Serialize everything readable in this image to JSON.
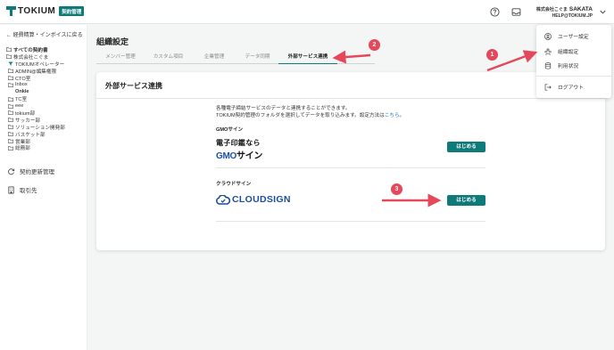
{
  "header": {
    "logo_text": "TOKIUM",
    "logo_badge": "契約管理",
    "user_company": "株式会社こぐま",
    "user_name": "SAKATA",
    "user_email": "HELP@TOKIUM.JP",
    "icons": [
      "help-icon",
      "inbox-icon",
      "chevron-down-icon"
    ]
  },
  "sidebar": {
    "back_link": "← 経費精算・インボイスに戻る",
    "tree": [
      {
        "label": "すべての契約書",
        "level": 0,
        "bold": true
      },
      {
        "label": "株式会社こぐま",
        "level": 0,
        "bold": false
      },
      {
        "label": "TOKIUMオペレーター",
        "level": 1,
        "bold": false,
        "icon": "filter"
      },
      {
        "label": "ADMIN@編集権限",
        "level": 1,
        "bold": false
      },
      {
        "label": "CTO室",
        "level": 1,
        "bold": false
      },
      {
        "label": "Inbox",
        "level": 1,
        "bold": false
      },
      {
        "label": "Onkle",
        "level": 1,
        "bold": true
      },
      {
        "label": "TC室",
        "level": 1,
        "bold": false
      },
      {
        "label": "eee",
        "level": 1,
        "bold": false
      },
      {
        "label": "tokium部",
        "level": 1,
        "bold": false
      },
      {
        "label": "サッカー部",
        "level": 1,
        "bold": false
      },
      {
        "label": "ソリューション開発部",
        "level": 1,
        "bold": false
      },
      {
        "label": "バスケット部",
        "level": 1,
        "bold": false
      },
      {
        "label": "営業部",
        "level": 1,
        "bold": false
      },
      {
        "label": "総務部",
        "level": 1,
        "bold": false
      }
    ],
    "nav": [
      {
        "label": "契約更新管理",
        "icon": "refresh-icon"
      },
      {
        "label": "取引先",
        "icon": "building-icon"
      }
    ]
  },
  "main": {
    "page_title": "組織設定",
    "tabs": [
      {
        "label": "メンバー管理",
        "active": false
      },
      {
        "label": "カスタム項目",
        "active": false
      },
      {
        "label": "企業管理",
        "active": false
      },
      {
        "label": "データ同期",
        "active": false
      },
      {
        "label": "外部サービス連携",
        "active": true
      }
    ],
    "card": {
      "title": "外部サービス連携",
      "desc_line1": "各種電子締結サービスのデータと連携することができます。",
      "desc_line2": "TOKIUM契約管理のフォルダを選択してデータを取り込みます。設定方法は",
      "desc_link": "こちら",
      "desc_end": "。",
      "services": [
        {
          "label": "GMOサイン",
          "logo_top": "電子印鑑なら",
          "logo_g": "GMO",
          "logo_rest": "サイン",
          "button": "はじめる"
        },
        {
          "label": "クラウドサイン",
          "logo_text": "CLOUDSIGN",
          "button": "はじめる"
        }
      ]
    }
  },
  "dropdown": {
    "items": [
      {
        "label": "ユーザー設定",
        "icon": "user-icon"
      },
      {
        "label": "組織設定",
        "icon": "organization-icon"
      },
      {
        "label": "利用状況",
        "icon": "database-icon"
      },
      {
        "label": "ログアウト",
        "icon": "logout-icon"
      }
    ]
  },
  "annotations": {
    "badges": [
      "1",
      "2",
      "3"
    ],
    "color": "#e5485a"
  },
  "colors": {
    "brand": "#0f7a7a",
    "annotation": "#e5485a",
    "link": "#1a6fc4"
  }
}
